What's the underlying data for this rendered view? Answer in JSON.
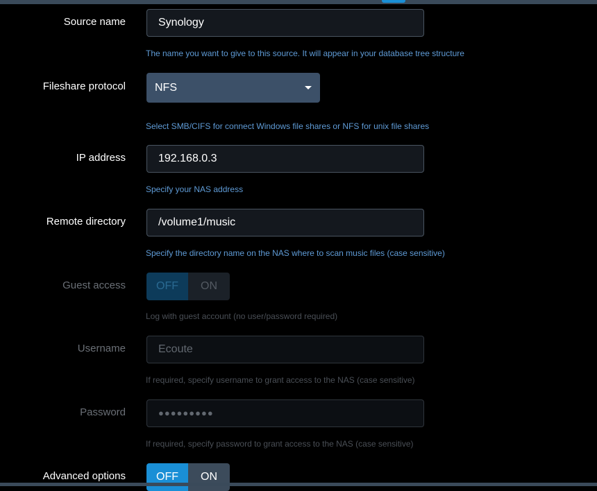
{
  "colors": {
    "accent": "#1a8fd6",
    "hint": "#5f9bd6",
    "select_bg": "#3c5068"
  },
  "source_name": {
    "label": "Source name",
    "value": "Synology",
    "hint": "The name you want to give to this source. It will appear in your database tree structure"
  },
  "protocol": {
    "label": "Fileshare protocol",
    "value": "NFS",
    "hint": "Select SMB/CIFS for connect Windows file shares or NFS for unix file shares",
    "icon": "chevron-down-icon"
  },
  "ip_address": {
    "label": "IP address",
    "value": "192.168.0.3",
    "hint": "Specify your NAS address"
  },
  "remote_directory": {
    "label": "Remote directory",
    "value": "/volume1/music",
    "hint": "Specify the directory name on the NAS where to scan music files (case sensitive)"
  },
  "guest_access": {
    "label": "Guest access",
    "off_label": "OFF",
    "on_label": "ON",
    "selected": "OFF",
    "hint": "Log with guest account (no user/password required)"
  },
  "username": {
    "label": "Username",
    "value": "Ecoute",
    "hint": "If required, specify username to grant access to the NAS (case sensitive)"
  },
  "password": {
    "label": "Password",
    "value": "●●●●●●●●●",
    "hint": "If required, specify password to grant access to the NAS (case sensitive)"
  },
  "advanced_options": {
    "label": "Advanced options",
    "off_label": "OFF",
    "on_label": "ON",
    "selected": "OFF"
  }
}
